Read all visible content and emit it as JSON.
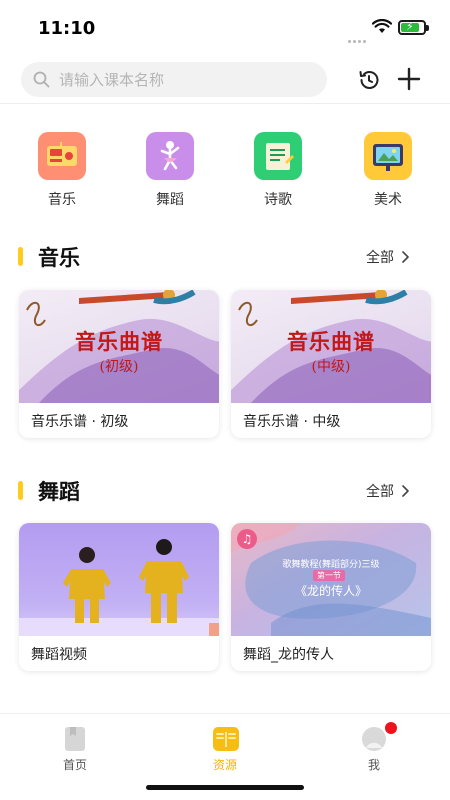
{
  "status_bar": {
    "time": "11:10"
  },
  "search": {
    "placeholder": "请输入课本名称"
  },
  "header_icons": [
    "history-icon",
    "plus-icon"
  ],
  "categories": [
    {
      "label": "音乐",
      "icon": "music-icon",
      "color": "#ff8f73"
    },
    {
      "label": "舞蹈",
      "icon": "dance-icon",
      "color": "#c98dea"
    },
    {
      "label": "诗歌",
      "icon": "poem-icon",
      "color": "#2ecf74"
    },
    {
      "label": "美术",
      "icon": "art-icon",
      "color": "#ffc938"
    }
  ],
  "sections": [
    {
      "title": "音乐",
      "more": "全部",
      "items": [
        {
          "caption": "音乐乐谱 · 初级",
          "thumb_title": "音乐曲谱",
          "thumb_level": "(初级)"
        },
        {
          "caption": "音乐乐谱 · 中级",
          "thumb_title": "音乐曲谱",
          "thumb_level": "(中级)"
        }
      ]
    },
    {
      "title": "舞蹈",
      "more": "全部",
      "items": [
        {
          "caption": "舞蹈视频"
        },
        {
          "caption": "舞蹈_龙的传人",
          "thumb_line1": "歌舞教程(舞蹈部分)三级",
          "thumb_line2": "第一节",
          "thumb_line3": "《龙的传人》"
        }
      ]
    }
  ],
  "tabs": [
    {
      "label": "首页",
      "icon": "book-icon",
      "active": false
    },
    {
      "label": "资源",
      "icon": "open-book-icon",
      "active": true
    },
    {
      "label": "我",
      "icon": "avatar-icon",
      "active": false,
      "badge": true
    }
  ],
  "colors": {
    "accent": "#ffcc1a",
    "active_tab": "#f5b400",
    "inactive_tab": "#555555",
    "badge": "#f0121b"
  }
}
